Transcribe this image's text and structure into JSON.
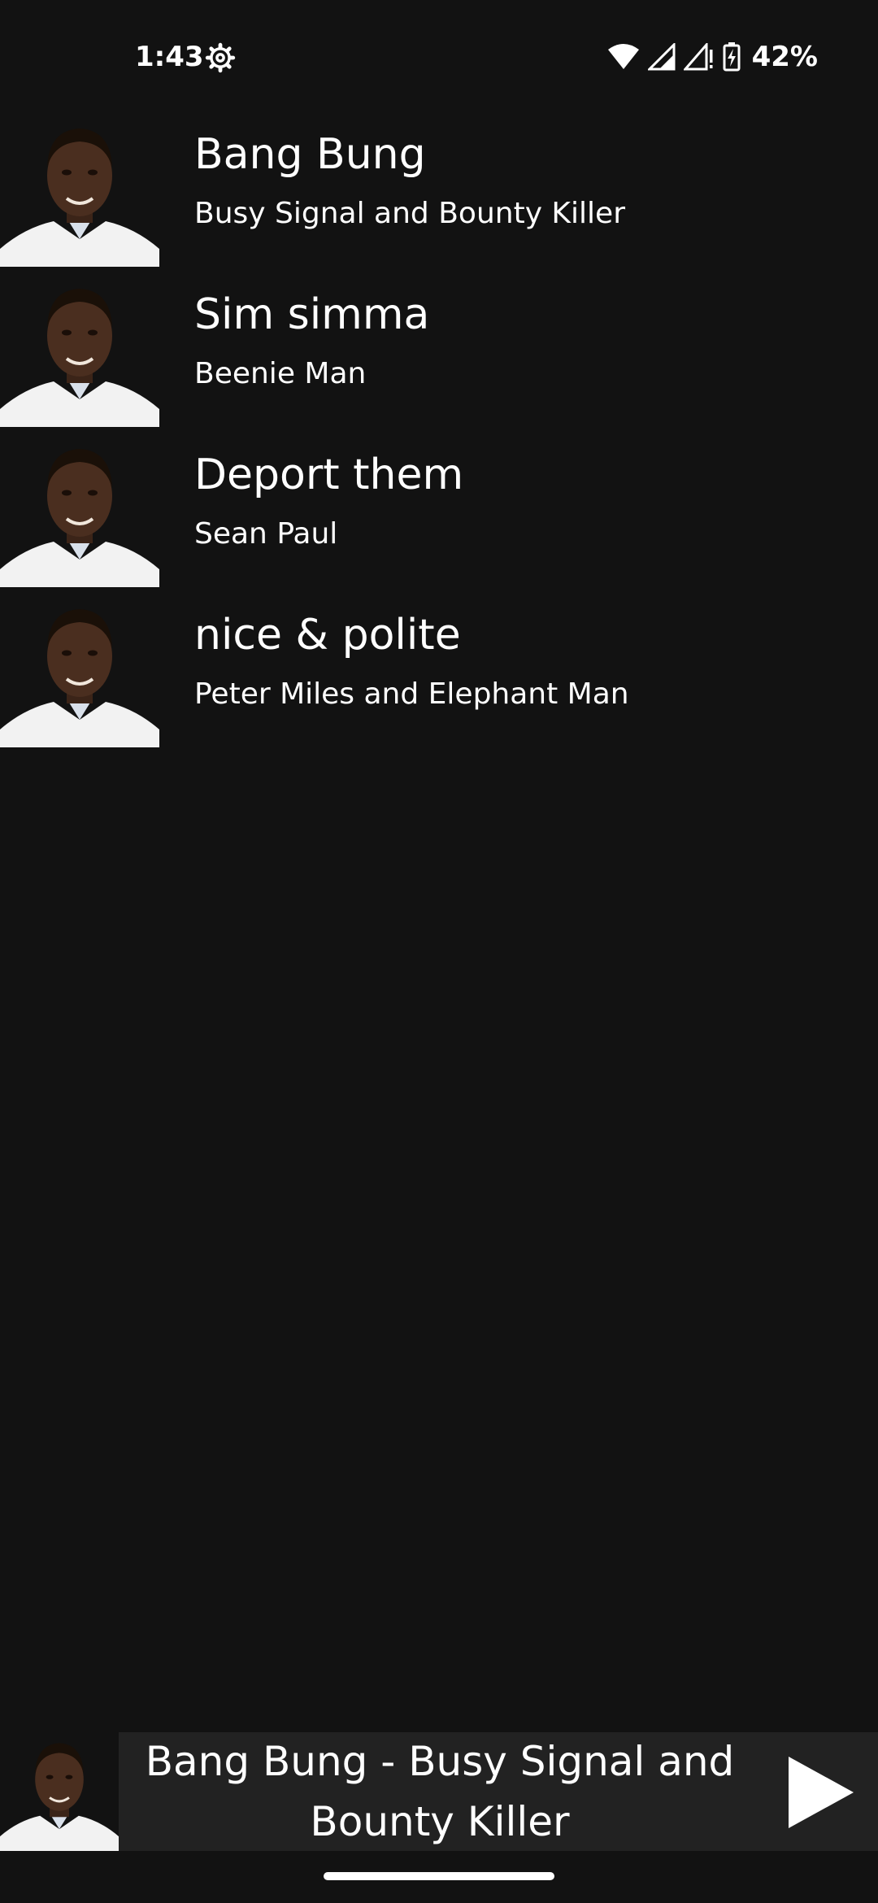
{
  "status_bar": {
    "time": "1:43",
    "battery": "42%",
    "icons": [
      "settings-gear-icon",
      "wifi-icon",
      "signal-icon",
      "signal-no-data-icon",
      "battery-charging-icon"
    ]
  },
  "songs": [
    {
      "title": "Bang Bung",
      "artist": "Busy Signal and Bounty Killer"
    },
    {
      "title": "Sim simma",
      "artist": "Beenie Man"
    },
    {
      "title": "Deport them",
      "artist": "Sean Paul"
    },
    {
      "title": "nice & polite",
      "artist": "Peter Miles and Elephant Man"
    }
  ],
  "now_playing": {
    "title": "Bang Bung - Busy Signal and Bounty Killer",
    "control_icon": "play-icon"
  },
  "colors": {
    "background": "#121212",
    "mini_player_bar": "#222222",
    "text": "#ffffff"
  }
}
